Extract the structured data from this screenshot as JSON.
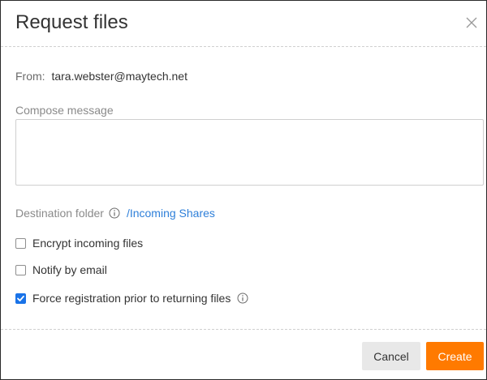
{
  "dialog": {
    "title": "Request files",
    "from_label": "From:",
    "from_value": "tara.webster@maytech.net",
    "compose_label": "Compose message",
    "compose_value": "",
    "destination_label": "Destination folder",
    "destination_value": "/Incoming Shares",
    "options": [
      {
        "label": "Encrypt incoming files",
        "checked": false
      },
      {
        "label": "Notify by email",
        "checked": false
      },
      {
        "label": "Force registration prior to returning files",
        "checked": true
      }
    ],
    "cancel_label": "Cancel",
    "create_label": "Create"
  },
  "colors": {
    "accent": "#ff7a00",
    "link": "#2e7fd9",
    "checkbox_checked": "#1a73e8"
  },
  "icons": {
    "close": "close-icon",
    "info": "info-icon",
    "check": "check-icon",
    "resize": "resize-grip-icon"
  }
}
